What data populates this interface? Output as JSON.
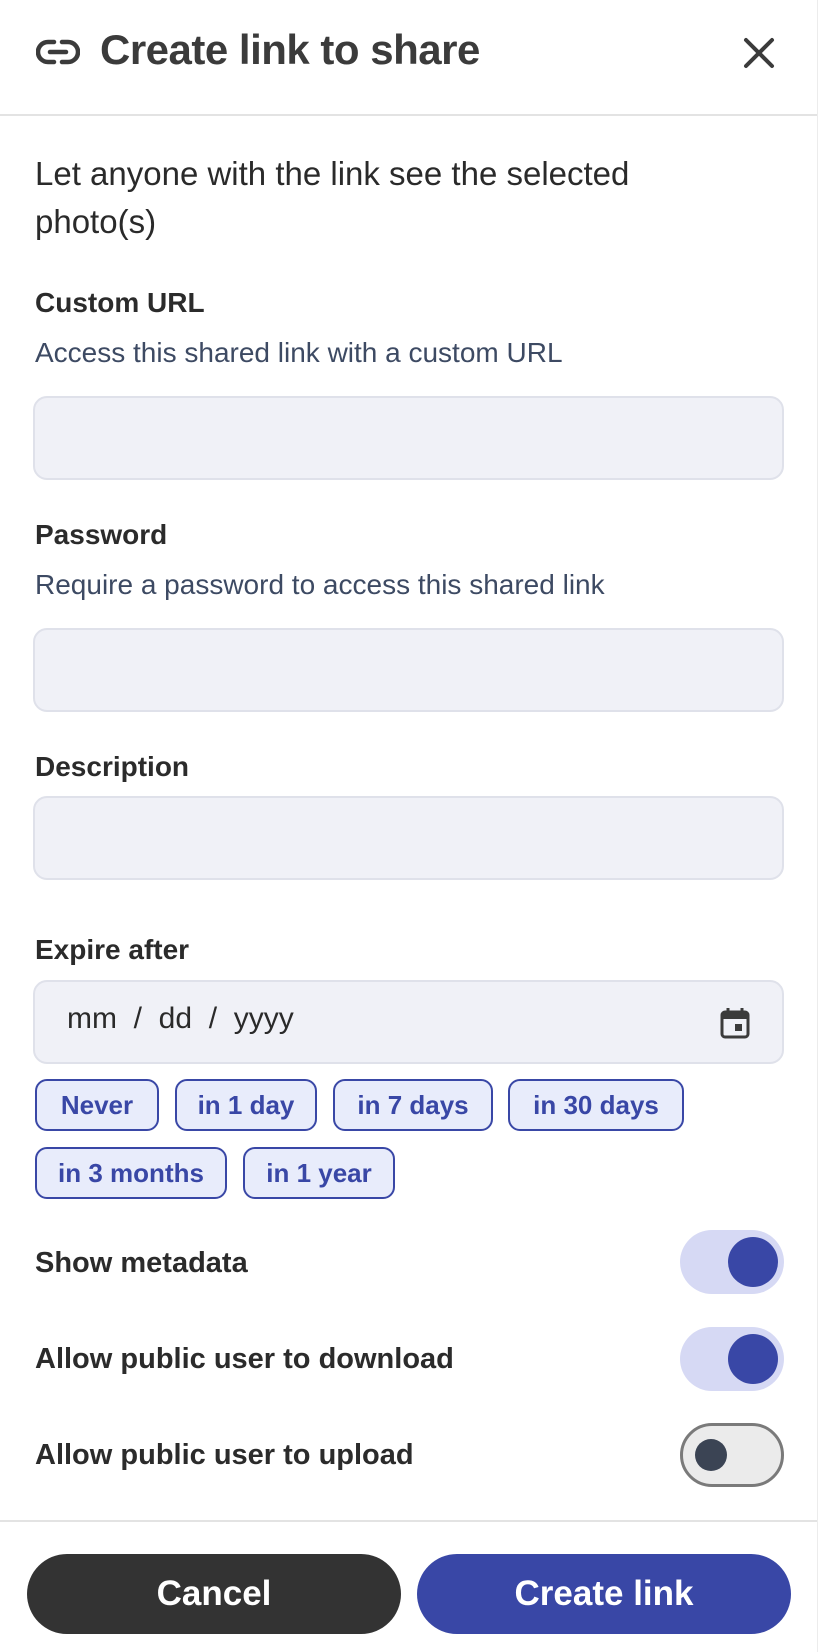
{
  "header": {
    "title": "Create link to share",
    "link_icon": "link-icon",
    "close_icon": "close-icon"
  },
  "intro": "Let anyone with the link see the selected photo(s)",
  "custom_url": {
    "label": "Custom URL",
    "help": "Access this shared link with a custom URL",
    "value": ""
  },
  "password": {
    "label": "Password",
    "help": "Require a password to access this shared link",
    "value": ""
  },
  "description": {
    "label": "Description",
    "value": ""
  },
  "expire": {
    "label": "Expire after",
    "placeholder": "mm  /  dd  /  yyyy",
    "calendar_icon": "calendar-icon",
    "chips": [
      "Never",
      "in 1 day",
      "in 7 days",
      "in 30 days",
      "in 3 months",
      "in 1 year"
    ]
  },
  "toggles": {
    "show_metadata": {
      "label": "Show metadata",
      "on": true
    },
    "allow_download": {
      "label": "Allow public user to download",
      "on": true
    },
    "allow_upload": {
      "label": "Allow public user to upload",
      "on": false
    }
  },
  "footer": {
    "cancel": "Cancel",
    "create": "Create link"
  },
  "colors": {
    "accent": "#3947a6",
    "chip_bg": "#e8ecfb",
    "input_bg": "#f0f1f7",
    "cancel_bg": "#333333",
    "help_text": "#3d4a63"
  }
}
